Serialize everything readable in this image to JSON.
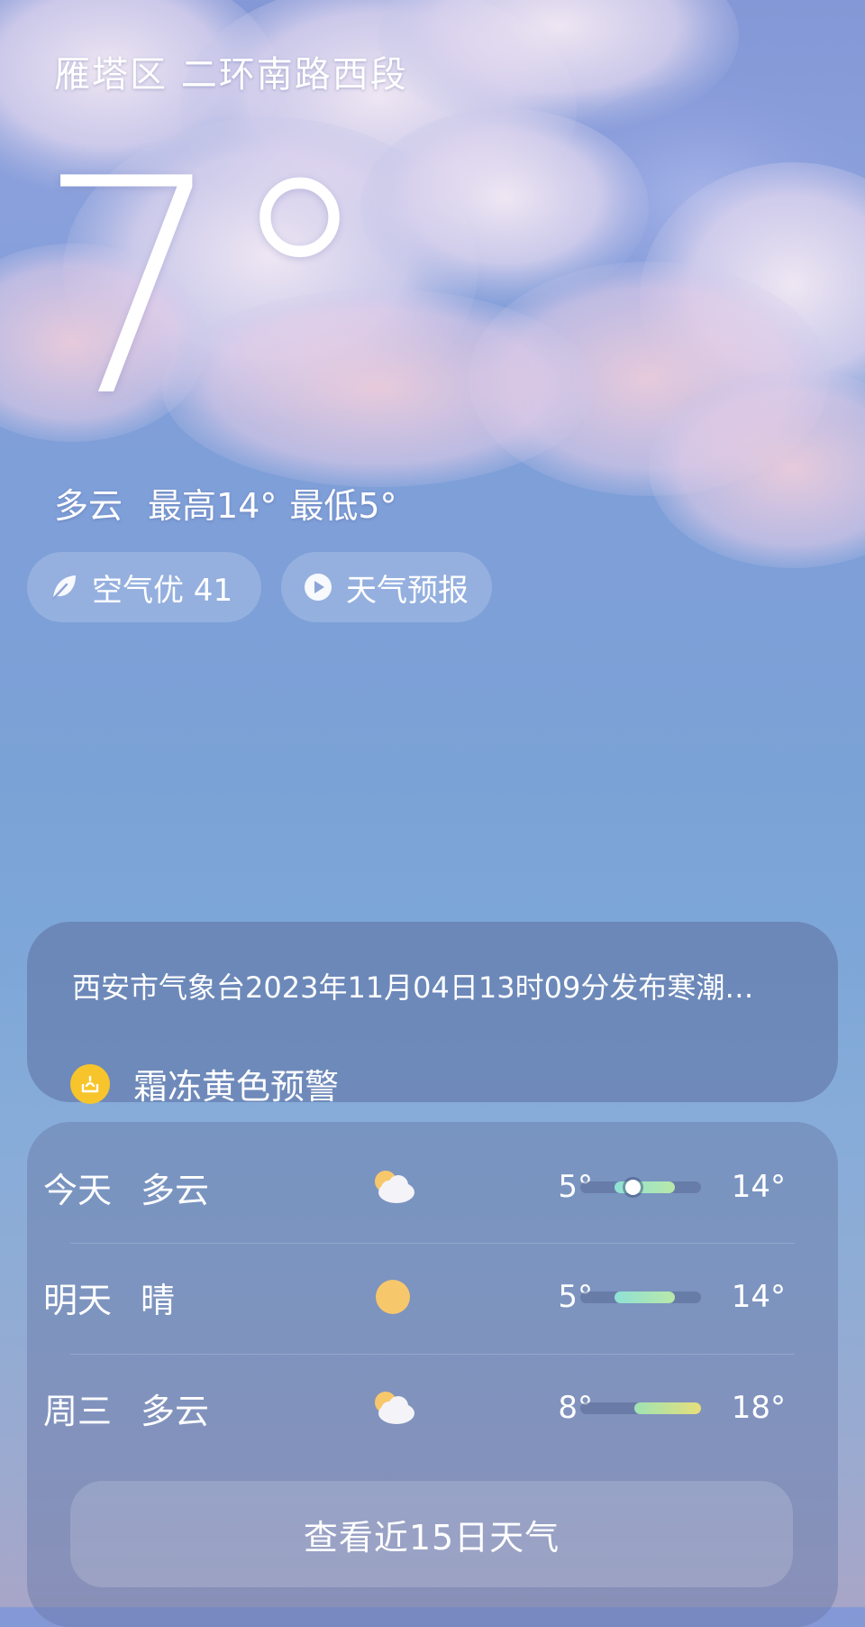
{
  "location": "雁塔区 二环南路西段",
  "current": {
    "temperature": "7°",
    "condition": "多云",
    "high": "最高14°",
    "low": "最低5°"
  },
  "pills": {
    "air_quality": "空气优 41",
    "forecast_video": "天气预报"
  },
  "alert": {
    "text": "西安市气象台2023年11月04日13时09分发布寒潮…",
    "tag": "霜冻黄色预警",
    "tag_color": "#f7c52b"
  },
  "forecast": [
    {
      "day": "今天",
      "condition": "多云",
      "icon": "partly-cloudy-icon",
      "low": "5°",
      "high": "14°",
      "range_start": 0.28,
      "range_end": 0.78,
      "now": 0.43
    },
    {
      "day": "明天",
      "condition": "晴",
      "icon": "sun-icon",
      "low": "5°",
      "high": "14°",
      "range_start": 0.28,
      "range_end": 0.78
    },
    {
      "day": "周三",
      "condition": "多云",
      "icon": "partly-cloudy-icon",
      "low": "8°",
      "high": "18°",
      "range_start": 0.45,
      "range_end": 1.0
    }
  ],
  "more_button": "查看近15日天气"
}
